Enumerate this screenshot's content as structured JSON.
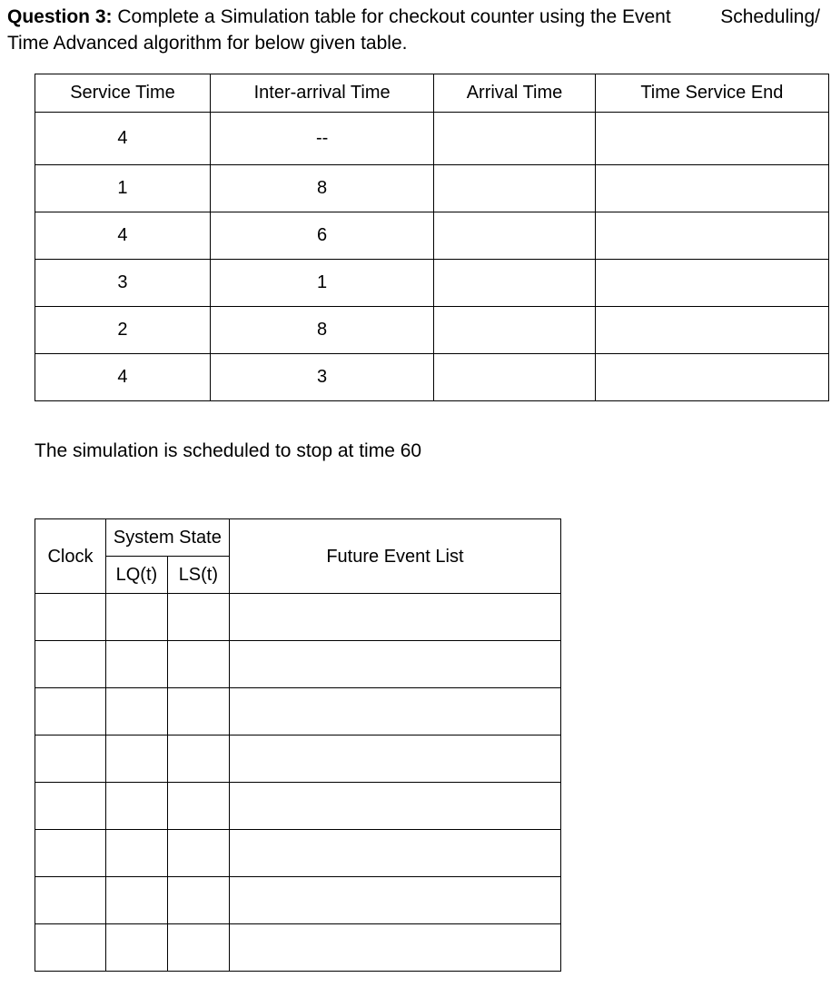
{
  "question": {
    "label": "Question 3:",
    "text_line1_a": " Complete a Simulation table for checkout counter using the Event",
    "text_right": "Scheduling/",
    "text_line2": "Time Advanced algorithm for below given table."
  },
  "table1": {
    "headers": [
      "Service Time",
      "Inter-arrival Time",
      "Arrival Time",
      "Time Service End"
    ],
    "rows": [
      [
        "4",
        "--",
        "",
        ""
      ],
      [
        "1",
        "8",
        "",
        ""
      ],
      [
        "4",
        "6",
        "",
        ""
      ],
      [
        "3",
        "1",
        "",
        ""
      ],
      [
        "2",
        "8",
        "",
        ""
      ],
      [
        "4",
        "3",
        "",
        ""
      ]
    ]
  },
  "mid_text": "The simulation is scheduled to stop at time 60",
  "table2": {
    "clock": "Clock",
    "system_state": "System State",
    "lq": "LQ(t)",
    "ls": "LS(t)",
    "fel": "Future Event List",
    "body_rows": 8
  }
}
